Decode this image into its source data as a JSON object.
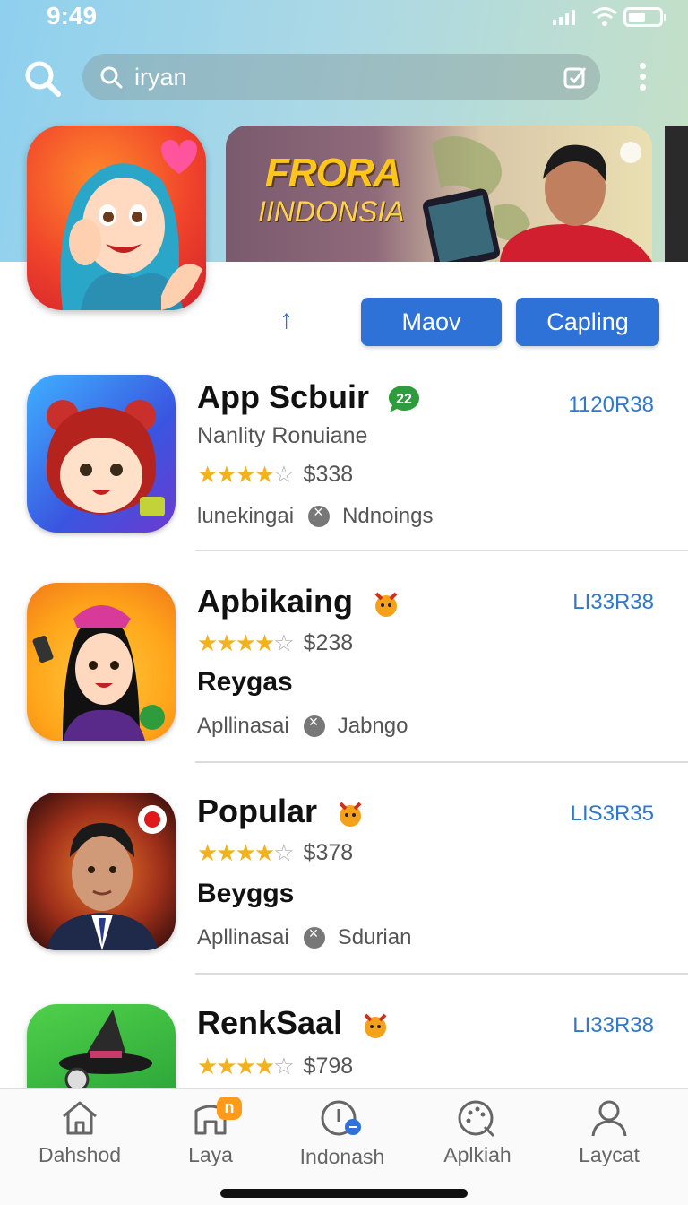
{
  "status_bar": {
    "time": "9:49"
  },
  "search": {
    "placeholder": "iryan",
    "value": ""
  },
  "banner": {
    "title": "FRORA",
    "subtitle": "IINDONSIA"
  },
  "actions": {
    "arrow": "↑",
    "primary_label": "Maov",
    "secondary_label": "Capling"
  },
  "apps": [
    {
      "name": "App Scbuir",
      "badge": "22",
      "subtitle": "Nanlity Ronuiane",
      "rating": 4,
      "price": "$338",
      "code": "1120R38",
      "meta_left": "lunekingai",
      "meta_right": "Ndnoings"
    },
    {
      "name": "Apbikaing",
      "rating": 4,
      "price": "$238",
      "subtitle": "Reygas",
      "code": "LI33R38",
      "meta_left": "Apllinasai",
      "meta_right": "Jabngo"
    },
    {
      "name": "Popular",
      "rating": 4,
      "price": "$378",
      "subtitle": "Beyggs",
      "code": "LIS3R35",
      "meta_left": "Apllinasai",
      "meta_right": "Sdurian"
    },
    {
      "name": "RenkSaal",
      "rating": 4,
      "price": "$798",
      "code": "LI33R38"
    }
  ],
  "bottom_nav": [
    {
      "label": "Dahshod",
      "icon": "home-icon"
    },
    {
      "label": "Laya",
      "icon": "store-icon",
      "badge": "n"
    },
    {
      "label": "Indonash",
      "icon": "info-icon"
    },
    {
      "label": "Aplkiah",
      "icon": "palette-icon"
    },
    {
      "label": "Laycat",
      "icon": "profile-icon"
    }
  ]
}
